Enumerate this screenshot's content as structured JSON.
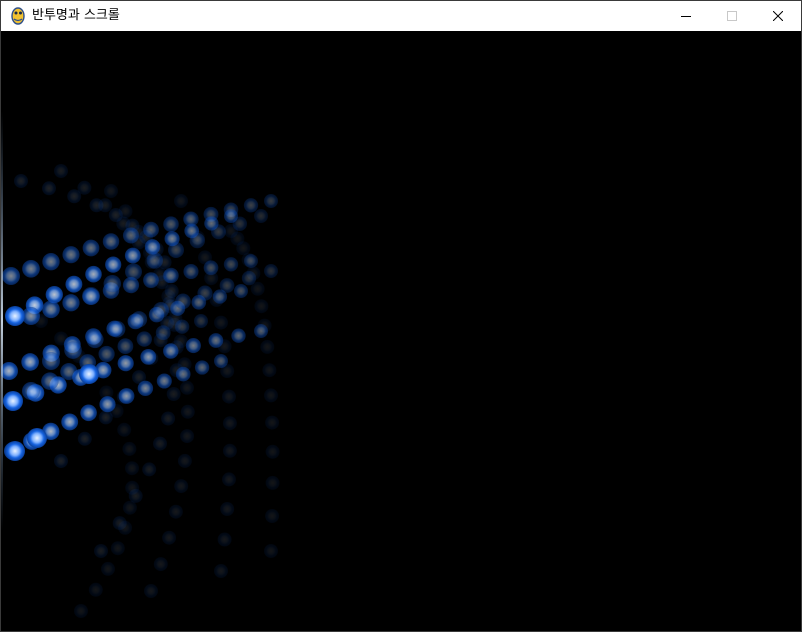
{
  "window": {
    "title": "반투명과 스크롤",
    "app_icon": "python-snake-icon",
    "controls": [
      "minimize-icon",
      "maximize-icon",
      "close-icon"
    ]
  },
  "scene": {
    "background": "#000000",
    "bead_color": "#0a5ad6",
    "bead_glow": "#1e6fe8",
    "bead_core": "#cfe4ff"
  }
}
